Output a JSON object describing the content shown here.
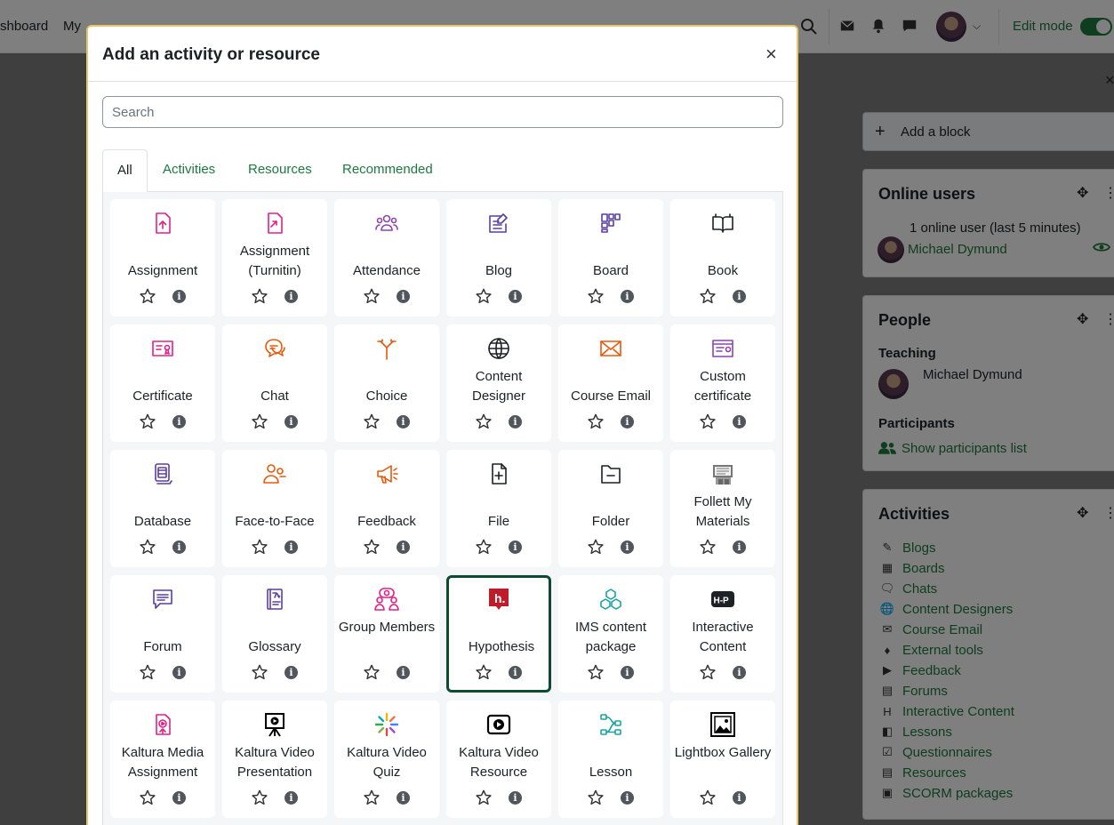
{
  "topnav": {
    "dashboard": "shboard",
    "my": "My",
    "edit_mode": "Edit mode"
  },
  "drawer": {
    "add_block": "Add a block",
    "online_users": {
      "title": "Online users",
      "summary": "1 online user (last 5 minutes)",
      "user": "Michael Dymund"
    },
    "people": {
      "title": "People",
      "teaching_label": "Teaching",
      "teacher": "Michael Dymund",
      "participants_label": "Participants",
      "show_participants": "Show participants list"
    },
    "activities": {
      "title": "Activities",
      "items": [
        {
          "label": "Blogs",
          "icon": "blog-icon"
        },
        {
          "label": "Boards",
          "icon": "board-icon"
        },
        {
          "label": "Chats",
          "icon": "chat-icon"
        },
        {
          "label": "Content Designers",
          "icon": "globe-icon"
        },
        {
          "label": "Course Email",
          "icon": "mail-icon"
        },
        {
          "label": "External tools",
          "icon": "puzzle-icon"
        },
        {
          "label": "Feedback",
          "icon": "megaphone-icon"
        },
        {
          "label": "Forums",
          "icon": "forum-icon"
        },
        {
          "label": "Interactive Content",
          "icon": "h5p-icon"
        },
        {
          "label": "Lessons",
          "icon": "lesson-icon"
        },
        {
          "label": "Questionnaires",
          "icon": "questionnaire-icon"
        },
        {
          "label": "Resources",
          "icon": "file-icon"
        },
        {
          "label": "SCORM packages",
          "icon": "package-icon"
        }
      ]
    }
  },
  "modal": {
    "title": "Add an activity or resource",
    "close": "×",
    "search_placeholder": "Search",
    "tabs": [
      "All",
      "Activities",
      "Resources",
      "Recommended"
    ],
    "cards": [
      {
        "name": "Assignment",
        "icon": "assignment-icon",
        "color": "#e0218a"
      },
      {
        "name": "Assignment (Turnitin)",
        "icon": "turnitin-icon",
        "color": "#e0218a"
      },
      {
        "name": "Attendance",
        "icon": "attendance-icon",
        "color": "#8e44ad"
      },
      {
        "name": "Blog",
        "icon": "blog-icon",
        "color": "#5b3fa0"
      },
      {
        "name": "Board",
        "icon": "board-icon",
        "color": "#5b3fa0"
      },
      {
        "name": "Book",
        "icon": "book-icon",
        "color": "#1d2125"
      },
      {
        "name": "Certificate",
        "icon": "certificate-icon",
        "color": "#e0218a"
      },
      {
        "name": "Chat",
        "icon": "chat-icon",
        "color": "#e8590c"
      },
      {
        "name": "Choice",
        "icon": "choice-icon",
        "color": "#e8590c"
      },
      {
        "name": "Content Designer",
        "icon": "globe-icon",
        "color": "#1d2125"
      },
      {
        "name": "Course Email",
        "icon": "mail-icon",
        "color": "#e8590c"
      },
      {
        "name": "Custom certificate",
        "icon": "custom-certificate-icon",
        "color": "#8e44ad"
      },
      {
        "name": "Database",
        "icon": "database-icon",
        "color": "#5b3fa0"
      },
      {
        "name": "Face-to-Face",
        "icon": "face-to-face-icon",
        "color": "#e8590c"
      },
      {
        "name": "Feedback",
        "icon": "megaphone-icon",
        "color": "#e8590c"
      },
      {
        "name": "File",
        "icon": "file-icon",
        "color": "#1d2125"
      },
      {
        "name": "Folder",
        "icon": "folder-icon",
        "color": "#1d2125"
      },
      {
        "name": "Follett My Materials",
        "icon": "follett-icon",
        "color": "#555555"
      },
      {
        "name": "Forum",
        "icon": "forum-icon",
        "color": "#5b3fa0"
      },
      {
        "name": "Glossary",
        "icon": "glossary-icon",
        "color": "#5b3fa0"
      },
      {
        "name": "Group Members",
        "icon": "group-members-icon",
        "color": "#e0218a"
      },
      {
        "name": "Hypothesis",
        "icon": "hypothesis-icon",
        "color": "#bd1c2b"
      },
      {
        "name": "IMS content package",
        "icon": "ims-package-icon",
        "color": "#1aa3a3"
      },
      {
        "name": "Interactive Content",
        "icon": "h5p-icon",
        "color": "#1d2125"
      },
      {
        "name": "Kaltura Media Assignment",
        "icon": "kaltura-assignment-icon",
        "color": "#e0218a"
      },
      {
        "name": "Kaltura Video Presentation",
        "icon": "kaltura-presentation-icon",
        "color": "#1d2125"
      },
      {
        "name": "Kaltura Video Quiz",
        "icon": "kaltura-quiz-icon",
        "color": "#1d2125"
      },
      {
        "name": "Kaltura Video Resource",
        "icon": "kaltura-resource-icon",
        "color": "#1d2125"
      },
      {
        "name": "Lesson",
        "icon": "lesson-icon",
        "color": "#1aa3a3"
      },
      {
        "name": "Lightbox Gallery",
        "icon": "lightbox-icon",
        "color": "#1d2125"
      }
    ],
    "selected": "Hypothesis"
  }
}
